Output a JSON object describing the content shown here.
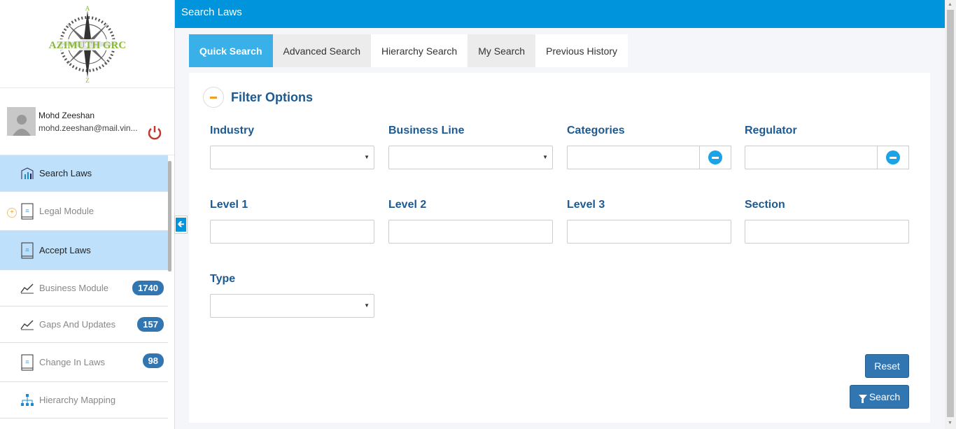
{
  "app": {
    "logo_text": "AZIMUTH GRC",
    "logo_top_letter": "A",
    "logo_bottom_letter": "Z"
  },
  "user": {
    "name": "Mohd Zeeshan",
    "email": "mohd.zeeshan@mail.vin..."
  },
  "sidebar": {
    "items": [
      {
        "label": "Search Laws",
        "icon": "building-chart-icon",
        "active": true,
        "badge": ""
      },
      {
        "label": "Legal Module",
        "icon": "law-book-icon",
        "active": false,
        "badge": ""
      },
      {
        "label": "Accept Laws",
        "icon": "law-book-icon",
        "active": true,
        "badge": ""
      },
      {
        "label": "Business Module",
        "icon": "line-chart-icon",
        "active": false,
        "badge": "1740"
      },
      {
        "label": "Gaps And Updates",
        "icon": "line-chart-icon",
        "active": false,
        "badge": "157"
      },
      {
        "label": "Change In Laws",
        "icon": "law-book-icon",
        "active": false,
        "badge": "98"
      },
      {
        "label": "Hierarchy Mapping",
        "icon": "hierarchy-icon",
        "active": false,
        "badge": ""
      }
    ]
  },
  "header": {
    "title": "Search Laws"
  },
  "tabs": [
    {
      "label": "Quick Search",
      "active": true
    },
    {
      "label": "Advanced Search",
      "active": false
    },
    {
      "label": "Hierarchy Search",
      "active": false
    },
    {
      "label": "My Search",
      "active": false
    },
    {
      "label": "Previous History",
      "active": false
    }
  ],
  "filter": {
    "title": "Filter Options",
    "fields": {
      "industry": {
        "label": "Industry",
        "value": ""
      },
      "business_line": {
        "label": "Business Line",
        "value": ""
      },
      "categories": {
        "label": "Categories",
        "value": ""
      },
      "regulator": {
        "label": "Regulator",
        "value": ""
      },
      "level1": {
        "label": "Level 1",
        "value": ""
      },
      "level2": {
        "label": "Level 2",
        "value": ""
      },
      "level3": {
        "label": "Level 3",
        "value": ""
      },
      "section": {
        "label": "Section",
        "value": ""
      },
      "type": {
        "label": "Type",
        "value": ""
      }
    }
  },
  "buttons": {
    "reset": "Reset",
    "search": "Search"
  },
  "colors": {
    "primary": "#0094dc",
    "active_tab": "#3ab0e8",
    "button": "#3276b1",
    "label": "#1c5a91",
    "active_menu": "#bfe0fa"
  }
}
